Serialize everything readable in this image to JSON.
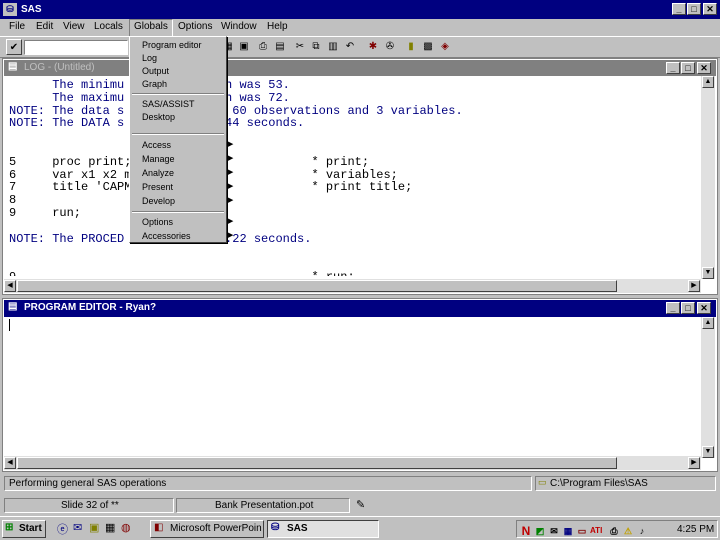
{
  "app": {
    "title": "SAS",
    "menus": [
      "File",
      "Edit",
      "View",
      "Locals",
      "Globals",
      "Options",
      "Window",
      "Help"
    ]
  },
  "toolbar": {
    "command_value": "",
    "icons": [
      "check-icon",
      "open-icon",
      "save-icon",
      "print-icon",
      "print-preview-icon",
      "cut-icon",
      "copy-icon",
      "paste-icon",
      "undo-icon",
      "submit-icon",
      "break-icon",
      "new-icon",
      "library-icon",
      "help-icon"
    ]
  },
  "globals_menu": {
    "items": [
      {
        "label": "Program editor",
        "submenu": false
      },
      {
        "label": "Log",
        "submenu": false
      },
      {
        "label": "Output",
        "submenu": false
      },
      {
        "label": "Graph",
        "submenu": false
      },
      {
        "label": "SAS/ASSIST",
        "submenu": false
      },
      {
        "label": "Desktop",
        "submenu": false
      },
      {
        "label": "Access",
        "submenu": true
      },
      {
        "label": "Manage",
        "submenu": true
      },
      {
        "label": "Analyze",
        "submenu": true
      },
      {
        "label": "Present",
        "submenu": true
      },
      {
        "label": "Develop",
        "submenu": true
      },
      {
        "label": "Options",
        "submenu": true
      },
      {
        "label": "Accessories",
        "submenu": true
      }
    ]
  },
  "log_window": {
    "title": "LOG - (Untitled)",
    "lines": [
      {
        "text": "      The minimu             th was 53.",
        "color": "note"
      },
      {
        "text": "      The maximu             th was 72.",
        "color": "note"
      },
      {
        "text": "NOTE: The data s           has 60 observations and 3 variables.",
        "color": "note"
      },
      {
        "text": "NOTE: The DATA s          d 0.44 seconds.",
        "color": "note"
      },
      {
        "text": "",
        "color": "note"
      },
      {
        "text": "",
        "color": "note"
      },
      {
        "text": "5     proc print;                         * print;",
        "color": "code"
      },
      {
        "text": "6     var x1 x2 m                         * variables;",
        "color": "code"
      },
      {
        "text": "7     title 'CAPM                         * print title;",
        "color": "code"
      },
      {
        "text": "8",
        "color": "code"
      },
      {
        "text": "9     run;",
        "color": "code"
      },
      {
        "text": "",
        "color": "note"
      },
      {
        "text": "NOTE: The PROCED          nd 0.22 seconds.",
        "color": "note"
      },
      {
        "text": "",
        "color": "note"
      },
      {
        "text": "",
        "color": "note"
      },
      {
        "text": "9                                         * run;",
        "color": "code"
      }
    ]
  },
  "program_editor": {
    "title": "PROGRAM EDITOR - Ryan?"
  },
  "status_bar": {
    "message": "Performing general SAS operations",
    "path": "C:\\Program Files\\SAS"
  },
  "ppt_status": {
    "slide": "Slide 32 of **",
    "template": "Bank Presentation.pot"
  },
  "taskbar": {
    "start_label": "Start",
    "tasks": [
      "Microsoft PowerPoin",
      "SAS"
    ],
    "clock": "4:25 PM",
    "tray_icons": [
      "N-icon",
      "network-icon",
      "mail-icon",
      "volume-icon",
      "monitor-icon",
      "ati-icon",
      "printer-icon",
      "antivirus-icon",
      "speaker-icon"
    ]
  },
  "colors": {
    "title_active": "#000080",
    "title_inactive": "#808080",
    "note_text": "#000080",
    "face": "#c0c0c0"
  }
}
